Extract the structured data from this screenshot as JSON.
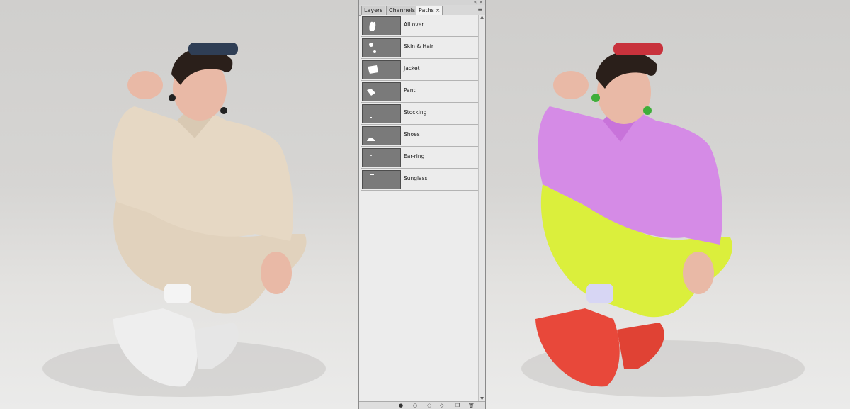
{
  "panel": {
    "tabs": [
      {
        "label": "Layers",
        "active": false
      },
      {
        "label": "Channels",
        "active": false
      },
      {
        "label": "Paths",
        "active": true
      }
    ],
    "close_glyph": "×",
    "menu_icon": "panel-menu-icon",
    "paths": [
      {
        "name": "All over"
      },
      {
        "name": "Skin & Hair"
      },
      {
        "name": "Jacket"
      },
      {
        "name": "Pant"
      },
      {
        "name": "Stocking"
      },
      {
        "name": "Shoes"
      },
      {
        "name": "Ear-ring"
      },
      {
        "name": "Sunglass"
      }
    ],
    "bottom_icons": [
      "fill-path-icon",
      "stroke-path-icon",
      "load-selection-icon",
      "make-work-path-icon",
      "new-path-icon",
      "delete-path-icon"
    ]
  },
  "colors": {
    "original_jacket": "#e6d8c4",
    "original_pant": "#e1d2bd",
    "original_shoes": "#eeeeee",
    "edited_jacket": "#d58be6",
    "edited_pant": "#dbef3c",
    "edited_shoes": "#e8483a",
    "edited_sunglass": "#c8323c",
    "edited_earring": "#3fae3a",
    "original_sunglass": "#2f3e55",
    "skin": "#e9b9a6",
    "hair": "#2a1f1a"
  }
}
